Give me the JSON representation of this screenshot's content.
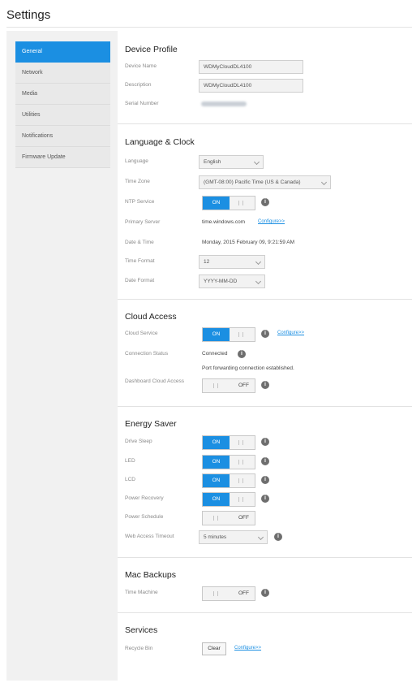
{
  "page": {
    "title": "Settings"
  },
  "sidebar": {
    "items": [
      {
        "label": "General"
      },
      {
        "label": "Network"
      },
      {
        "label": "Media"
      },
      {
        "label": "Utilities"
      },
      {
        "label": "Notifications"
      },
      {
        "label": "Firmware Update"
      }
    ]
  },
  "device_profile": {
    "heading": "Device Profile",
    "device_name": {
      "label": "Device Name",
      "value": "WDMyCloudDL4100"
    },
    "description": {
      "label": "Description",
      "value": "WDMyCloudDL4100"
    },
    "serial": {
      "label": "Serial Number"
    }
  },
  "language_clock": {
    "heading": "Language & Clock",
    "language": {
      "label": "Language",
      "value": "English"
    },
    "time_zone": {
      "label": "Time Zone",
      "value": "(GMT-08:00) Pacific Time (US & Canada)"
    },
    "ntp": {
      "label": "NTP Service",
      "on_label": "ON"
    },
    "primary_server": {
      "label": "Primary Server",
      "value": "time.windows.com",
      "link": "Configure>>"
    },
    "date_time": {
      "label": "Date & Time",
      "value": "Monday, 2015 February 09, 9:21:59 AM"
    },
    "time_format": {
      "label": "Time Format",
      "value": "12"
    },
    "date_format": {
      "label": "Date Format",
      "value": "YYYY-MM-DD"
    }
  },
  "cloud_access": {
    "heading": "Cloud Access",
    "cloud_service": {
      "label": "Cloud Service",
      "on_label": "ON",
      "link": "Configure>>"
    },
    "connection_status": {
      "label": "Connection Status",
      "value": "Connected",
      "detail": "Port forwarding connection established."
    },
    "dashboard_cloud": {
      "label": "Dashboard Cloud Access",
      "off_label": "OFF"
    }
  },
  "energy_saver": {
    "heading": "Energy Saver",
    "drive_sleep": {
      "label": "Drive Sleep",
      "on_label": "ON"
    },
    "led": {
      "label": "LED",
      "on_label": "ON"
    },
    "lcd": {
      "label": "LCD",
      "on_label": "ON"
    },
    "power_recovery": {
      "label": "Power Recovery",
      "on_label": "ON"
    },
    "power_schedule": {
      "label": "Power Schedule",
      "off_label": "OFF"
    },
    "web_access_timeout": {
      "label": "Web Access Timeout",
      "value": "5 minutes"
    }
  },
  "mac_backups": {
    "heading": "Mac Backups",
    "time_machine": {
      "label": "Time Machine",
      "off_label": "OFF"
    }
  },
  "services": {
    "heading": "Services",
    "recycle_bin": {
      "label": "Recycle Bin",
      "button": "Clear",
      "link": "Configure>>"
    }
  },
  "icons": {
    "info": "info-icon",
    "info_glyph": "i"
  },
  "colors": {
    "accent": "#1b8fe2",
    "sidebar_bg": "#e9e9e9",
    "page_bg": "#f1f1f1"
  }
}
